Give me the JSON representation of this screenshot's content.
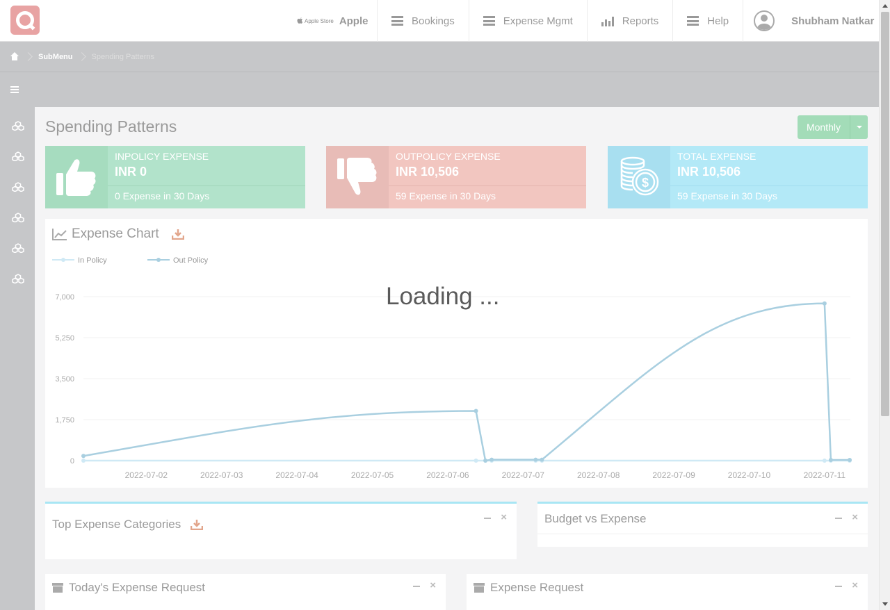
{
  "header": {
    "app_store_label": "Apple Store",
    "company_name": "Apple",
    "nav": [
      {
        "label": "Bookings",
        "icon": "list-icon"
      },
      {
        "label": "Expense Mgmt",
        "icon": "list-icon"
      },
      {
        "label": "Reports",
        "icon": "bar-chart-icon"
      },
      {
        "label": "Help",
        "icon": "list-icon"
      }
    ],
    "user_name": "Shubham Natkar"
  },
  "breadcrumb": {
    "items": [
      "SubMenu",
      "Spending Patterns"
    ]
  },
  "page": {
    "title": "Spending Patterns",
    "period": "Monthly"
  },
  "stats": [
    {
      "label": "INPOLICY EXPENSE",
      "value": "INR 0",
      "sub": "0 Expense in 30 Days",
      "icon": "thumbs-up-icon"
    },
    {
      "label": "OUTPOLICY EXPENSE",
      "value": "INR 10,506",
      "sub": "59 Expense in 30 Days",
      "icon": "thumbs-down-icon"
    },
    {
      "label": "TOTAL EXPENSE",
      "value": "INR 10,506",
      "sub": "59 Expense in 30 Days",
      "icon": "coins-icon"
    }
  ],
  "chart_panel": {
    "title": "Expense Chart",
    "loading_text": "Loading ..."
  },
  "chart_data": {
    "type": "line",
    "legend": [
      "In Policy",
      "Out Policy"
    ],
    "legend_position": "top-left",
    "grid": true,
    "y_ticks": [
      "0",
      "1,750",
      "3,500",
      "5,250",
      "7,000"
    ],
    "ylim": [
      0,
      7000
    ],
    "x_ticks": [
      "2022-07-02",
      "2022-07-03",
      "2022-07-04",
      "2022-07-05",
      "2022-07-06",
      "2022-07-07",
      "2022-07-08",
      "2022-07-09",
      "2022-07-10",
      "2022-07-11"
    ],
    "xlim": [
      "2022-07-01T16:00",
      "2022-07-11T20:00"
    ],
    "series": [
      {
        "name": "In Policy",
        "color": "#cfe9f5",
        "points": [
          [
            "2022-07-01T16:00",
            0
          ],
          [
            "2022-07-06T21:00",
            0
          ],
          [
            "2022-07-07T00:00",
            0
          ],
          [
            "2022-07-07T02:00",
            0
          ],
          [
            "2022-07-07T16:00",
            0
          ],
          [
            "2022-07-07T18:00",
            0
          ],
          [
            "2022-07-11T12:00",
            0
          ],
          [
            "2022-07-11T14:00",
            0
          ],
          [
            "2022-07-11T20:00",
            0
          ]
        ]
      },
      {
        "name": "Out Policy",
        "color": "#a9cfe0",
        "points": [
          [
            "2022-07-01T16:00",
            200
          ],
          [
            "2022-07-06T21:00",
            2120
          ],
          [
            "2022-07-07T00:00",
            0
          ],
          [
            "2022-07-07T02:00",
            40
          ],
          [
            "2022-07-07T16:00",
            40
          ],
          [
            "2022-07-07T18:00",
            40
          ],
          [
            "2022-07-11T12:00",
            6710
          ],
          [
            "2022-07-11T14:00",
            30
          ],
          [
            "2022-07-11T20:00",
            30
          ]
        ]
      }
    ]
  },
  "panels": {
    "top_categories": "Top Expense Categories",
    "budget_vs_expense": "Budget vs Expense",
    "todays_requests": "Today's Expense Request",
    "expense_request": "Expense Request"
  },
  "colors": {
    "inpolicy": "#b2e3cb",
    "outpolicy": "#f2c6c0",
    "total": "#b3e9f7",
    "accent_button": "#a3dcb8",
    "sidebar": "#c6c7c9"
  }
}
